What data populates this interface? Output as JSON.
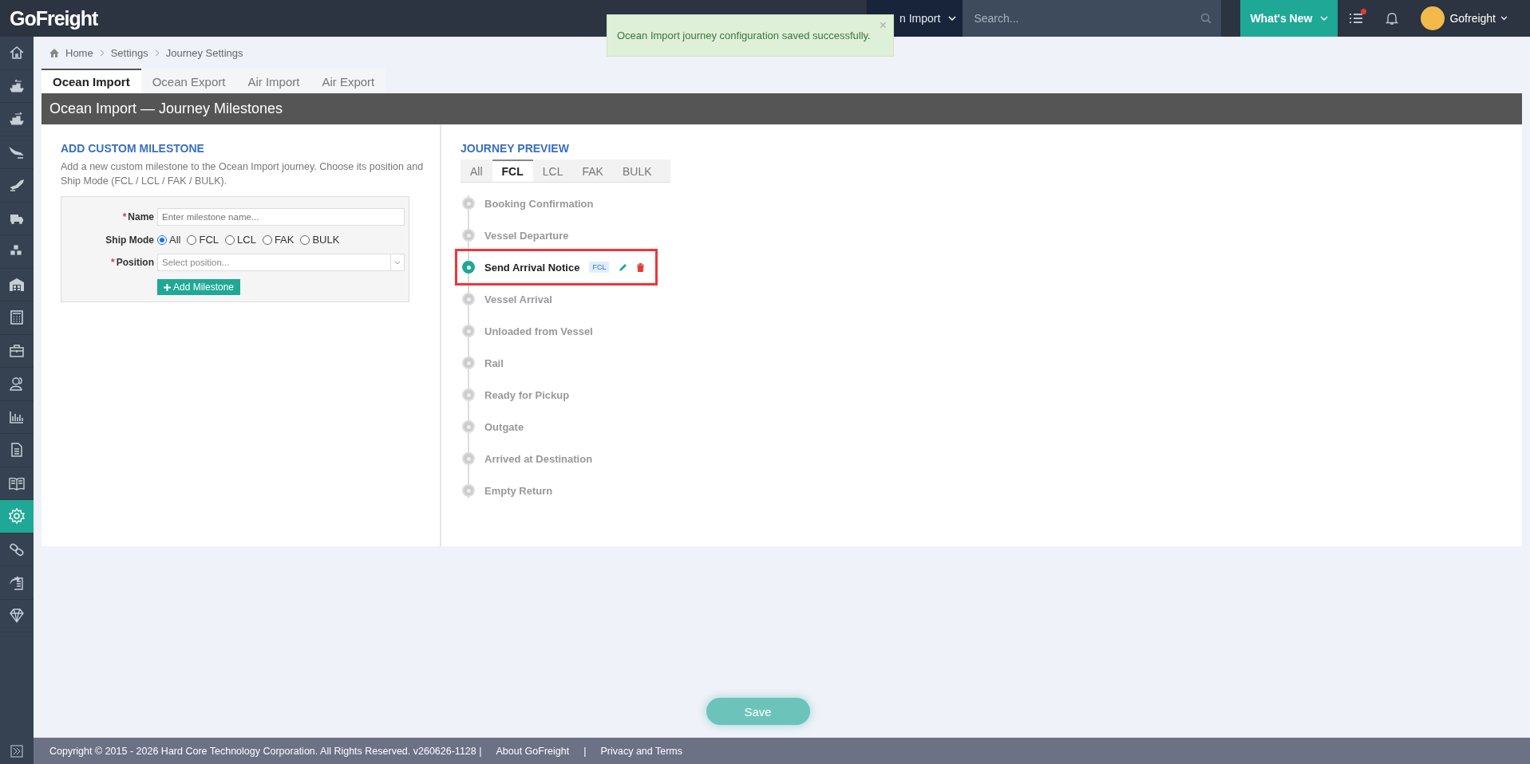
{
  "top_bar": {
    "logo": "GoFreight",
    "mode_dropdown": "n Import",
    "search": {
      "placeholder": "Search..."
    },
    "whats_new": "What's New",
    "notifications_dot": true,
    "user": "Gofreight"
  },
  "toast": {
    "message": "Ocean Import journey configuration saved successfully.",
    "close": "×"
  },
  "sidebar": {
    "items": [
      {
        "kind": "home",
        "selected": false
      },
      {
        "kind": "ship-in",
        "selected": false
      },
      {
        "kind": "ship-out",
        "selected": false
      },
      {
        "kind": "plane-land",
        "selected": false
      },
      {
        "kind": "plane-takeoff",
        "selected": false
      },
      {
        "kind": "truck",
        "selected": false
      },
      {
        "kind": "boxes",
        "selected": false
      },
      {
        "kind": "warehouse",
        "selected": false
      },
      {
        "kind": "calculator",
        "selected": false
      },
      {
        "kind": "briefcase",
        "selected": false
      },
      {
        "kind": "users",
        "selected": false
      },
      {
        "kind": "chart",
        "selected": false
      },
      {
        "kind": "document",
        "selected": false
      },
      {
        "kind": "book",
        "selected": false
      },
      {
        "kind": "gear",
        "selected": true
      },
      {
        "kind": "link",
        "selected": false
      },
      {
        "kind": "share",
        "selected": false
      },
      {
        "kind": "diamond",
        "selected": false
      }
    ]
  },
  "breadcrumb": [
    "Home",
    "Settings",
    "Journey Settings"
  ],
  "tabs": [
    {
      "label": "Ocean Import",
      "selected": true
    },
    {
      "label": "Ocean Export",
      "selected": false
    },
    {
      "label": "Air Import",
      "selected": false
    },
    {
      "label": "Air Export",
      "selected": false
    }
  ],
  "panel_title": "Ocean Import — Journey Milestones",
  "add_form": {
    "heading": "ADD CUSTOM MILESTONE",
    "description": "Add a new custom milestone to the Ocean Import journey. Choose its position and Ship Mode (FCL / LCL / FAK / BULK).",
    "required_mark": "*",
    "name_label": "Name",
    "name_placeholder": "Enter milestone name...",
    "ship_mode_label": "Ship Mode",
    "ship_modes": [
      {
        "label": "All",
        "selected": true
      },
      {
        "label": "FCL",
        "selected": false
      },
      {
        "label": "LCL",
        "selected": false
      },
      {
        "label": "FAK",
        "selected": false
      },
      {
        "label": "BULK",
        "selected": false
      }
    ],
    "position_label": "Position",
    "position_placeholder": "Select position...",
    "add_button": "Add Milestone"
  },
  "preview": {
    "heading": "JOURNEY PREVIEW",
    "filters": [
      {
        "label": "All",
        "selected": false
      },
      {
        "label": "FCL",
        "selected": true
      },
      {
        "label": "LCL",
        "selected": false
      },
      {
        "label": "FAK",
        "selected": false
      },
      {
        "label": "BULK",
        "selected": false
      }
    ],
    "milestones": [
      {
        "label": "Booking Confirmation",
        "selected": false,
        "boxed": false
      },
      {
        "label": "Vessel Departure",
        "selected": false,
        "boxed": false
      },
      {
        "label": "Send Arrival Notice",
        "selected": true,
        "boxed": true,
        "badge": "FCL"
      },
      {
        "label": "Vessel Arrival",
        "selected": false,
        "boxed": false
      },
      {
        "label": "Unloaded from Vessel",
        "selected": false,
        "boxed": false
      },
      {
        "label": "Rail",
        "selected": false,
        "boxed": false
      },
      {
        "label": "Ready for Pickup",
        "selected": false,
        "boxed": false
      },
      {
        "label": "Outgate",
        "selected": false,
        "boxed": false
      },
      {
        "label": "Arrived at Destination",
        "selected": false,
        "boxed": false
      },
      {
        "label": "Empty Return",
        "selected": false,
        "boxed": false
      }
    ]
  },
  "save_button": "Save",
  "footer": {
    "copyright": "Copyright © 2015 - 2026 Hard Core Technology Corporation. All Rights Reserved. v260626-1128 |",
    "links": [
      "About GoFreight",
      "Privacy and Terms"
    ],
    "separator": "|"
  }
}
